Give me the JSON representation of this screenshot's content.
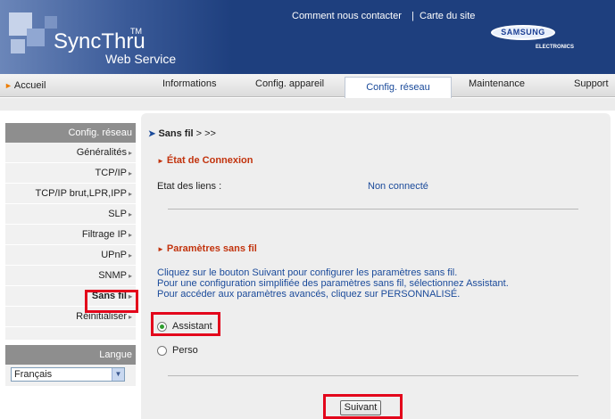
{
  "header": {
    "logo_main": "SyncThru",
    "logo_tm": "TM",
    "logo_sub": "Web Service",
    "links": [
      "Comment nous contacter",
      "|",
      "Carte du site"
    ],
    "brand": "SAMSUNG",
    "brand_sub": "ELECTRONICS"
  },
  "nav": {
    "home": "Accueil",
    "tabs": [
      "Informations",
      "Config. appareil",
      "Config. réseau",
      "Maintenance",
      "Support"
    ],
    "active_tab": "Config. réseau"
  },
  "sidebar": {
    "heading": "Config. réseau",
    "items": [
      "Généralités",
      "TCP/IP",
      "TCP/IP brut,LPR,IPP",
      "SLP",
      "Filtrage IP",
      "UPnP",
      "SNMP",
      "Sans fil",
      "Réinitialiser"
    ],
    "active_item": "Sans fil",
    "language_heading": "Langue",
    "language_value": "Français"
  },
  "content": {
    "breadcrumb": "Sans fil",
    "breadcrumb_rest": " > >>",
    "section1_title": "État de Connexion",
    "link_status_label": "Etat des liens :",
    "link_status_value": "Non connecté",
    "section2_title": "Paramètres sans fil",
    "desc_lines": [
      "Cliquez sur le bouton Suivant pour configurer les paramètres sans fil.",
      "Pour une configuration simplifiée des paramètres sans fil, sélectionnez Assistant.",
      "Pour accéder aux paramètres avancés, cliquez sur PERSONNALISÉ."
    ],
    "options": [
      "Assistant",
      "Perso"
    ],
    "selected_option": "Assistant",
    "next_button": "Suivant"
  },
  "colors": {
    "header_bg": "#1e3f7e",
    "section_title": "#c2330d",
    "link_blue": "#1a4a9a",
    "highlight_red": "#e3051b"
  }
}
